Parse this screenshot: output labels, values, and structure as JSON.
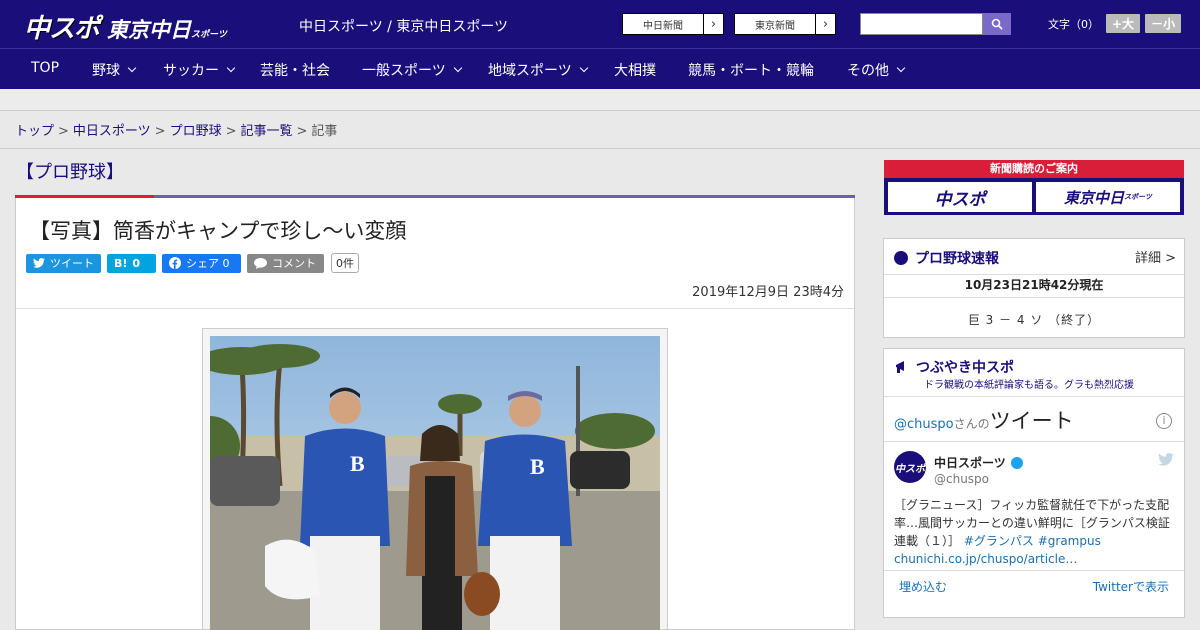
{
  "header": {
    "logo_main": "中スポ",
    "logo_sub": "東京中日",
    "logo_sub_small": "スポーツ",
    "site_names": "中日スポーツ / 東京中日スポーツ",
    "paper_buttons": [
      {
        "label": "中日新聞",
        "arrow": "›"
      },
      {
        "label": "東京新聞",
        "arrow": "›"
      }
    ],
    "search_placeholder": "",
    "font_size_label": "文字（0）",
    "font_plus": "+大",
    "font_minus": "－小"
  },
  "nav": {
    "items": [
      {
        "label": "TOP",
        "dropdown": false
      },
      {
        "label": "野球",
        "dropdown": true
      },
      {
        "label": "サッカー",
        "dropdown": true
      },
      {
        "label": "芸能・社会",
        "dropdown": false
      },
      {
        "label": "一般スポーツ",
        "dropdown": true
      },
      {
        "label": "地域スポーツ",
        "dropdown": true
      },
      {
        "label": "大相撲",
        "dropdown": false
      },
      {
        "label": "競馬・ボート・競輪",
        "dropdown": false
      },
      {
        "label": "その他",
        "dropdown": true
      }
    ]
  },
  "breadcrumb": {
    "items": [
      "トップ",
      "中日スポーツ",
      "プロ野球",
      "記事一覧"
    ],
    "current": "記事",
    "separator": ">"
  },
  "article": {
    "section": "【プロ野球】",
    "headline": "【写真】筒香がキャンプで珍し～い変顔",
    "share": {
      "tweet": "ツイート",
      "hatena_icon": "B!",
      "hatena_count": "0",
      "facebook": "シェア 0",
      "comment": "コメント",
      "comment_count": "0件"
    },
    "date": "2019年12月9日 23時4分"
  },
  "sidebar": {
    "banner_head": "新聞購読のご案内",
    "banner_left": "中スポ",
    "banner_right": "東京中日",
    "banner_right_small": "スポーツ",
    "scores": {
      "title": "プロ野球速報",
      "detail": "詳細 >",
      "status": "10月23日21時42分現在",
      "game": "巨 3 － 4 ソ （終了）"
    },
    "twitter": {
      "title": "つぶやき中スポ",
      "subtitle": "ドラ観戦の本紙評論家も語る。グラも熱烈応援",
      "handle_head": "@chuspo",
      "san": "さんの",
      "tweets_word": "ツイート",
      "info": "i",
      "avatar_text": "中スポ",
      "name": "中日スポーツ",
      "handle": "@chuspo",
      "text": "［グラニュース］フィッカ監督就任で下がった支配率…風間サッカーとの違い鮮明に［グランパス検証連載（１）］",
      "tags": "#グランパス #grampus",
      "link": "chunichi.co.jp/chuspo/article…",
      "embed": "埋め込む",
      "view_on": "Twitterで表示"
    }
  },
  "colors": {
    "brand_navy": "#1a0f7a",
    "accent_red": "#d91e3a",
    "link_blue": "#1b6fb0"
  }
}
